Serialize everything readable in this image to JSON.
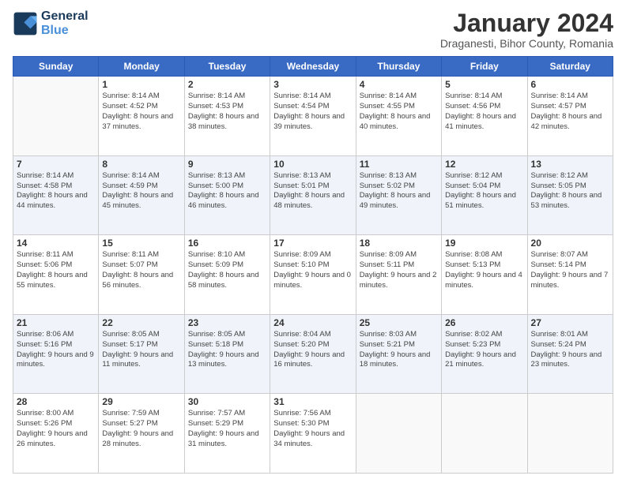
{
  "logo": {
    "line1": "General",
    "line2": "Blue"
  },
  "title": "January 2024",
  "subtitle": "Draganesti, Bihor County, Romania",
  "weekdays": [
    "Sunday",
    "Monday",
    "Tuesday",
    "Wednesday",
    "Thursday",
    "Friday",
    "Saturday"
  ],
  "weeks": [
    [
      {
        "day": "",
        "sunrise": "",
        "sunset": "",
        "daylight": ""
      },
      {
        "day": "1",
        "sunrise": "8:14 AM",
        "sunset": "4:52 PM",
        "daylight": "8 hours and 37 minutes."
      },
      {
        "day": "2",
        "sunrise": "8:14 AM",
        "sunset": "4:53 PM",
        "daylight": "8 hours and 38 minutes."
      },
      {
        "day": "3",
        "sunrise": "8:14 AM",
        "sunset": "4:54 PM",
        "daylight": "8 hours and 39 minutes."
      },
      {
        "day": "4",
        "sunrise": "8:14 AM",
        "sunset": "4:55 PM",
        "daylight": "8 hours and 40 minutes."
      },
      {
        "day": "5",
        "sunrise": "8:14 AM",
        "sunset": "4:56 PM",
        "daylight": "8 hours and 41 minutes."
      },
      {
        "day": "6",
        "sunrise": "8:14 AM",
        "sunset": "4:57 PM",
        "daylight": "8 hours and 42 minutes."
      }
    ],
    [
      {
        "day": "7",
        "sunrise": "8:14 AM",
        "sunset": "4:58 PM",
        "daylight": "8 hours and 44 minutes."
      },
      {
        "day": "8",
        "sunrise": "8:14 AM",
        "sunset": "4:59 PM",
        "daylight": "8 hours and 45 minutes."
      },
      {
        "day": "9",
        "sunrise": "8:13 AM",
        "sunset": "5:00 PM",
        "daylight": "8 hours and 46 minutes."
      },
      {
        "day": "10",
        "sunrise": "8:13 AM",
        "sunset": "5:01 PM",
        "daylight": "8 hours and 48 minutes."
      },
      {
        "day": "11",
        "sunrise": "8:13 AM",
        "sunset": "5:02 PM",
        "daylight": "8 hours and 49 minutes."
      },
      {
        "day": "12",
        "sunrise": "8:12 AM",
        "sunset": "5:04 PM",
        "daylight": "8 hours and 51 minutes."
      },
      {
        "day": "13",
        "sunrise": "8:12 AM",
        "sunset": "5:05 PM",
        "daylight": "8 hours and 53 minutes."
      }
    ],
    [
      {
        "day": "14",
        "sunrise": "8:11 AM",
        "sunset": "5:06 PM",
        "daylight": "8 hours and 55 minutes."
      },
      {
        "day": "15",
        "sunrise": "8:11 AM",
        "sunset": "5:07 PM",
        "daylight": "8 hours and 56 minutes."
      },
      {
        "day": "16",
        "sunrise": "8:10 AM",
        "sunset": "5:09 PM",
        "daylight": "8 hours and 58 minutes."
      },
      {
        "day": "17",
        "sunrise": "8:09 AM",
        "sunset": "5:10 PM",
        "daylight": "9 hours and 0 minutes."
      },
      {
        "day": "18",
        "sunrise": "8:09 AM",
        "sunset": "5:11 PM",
        "daylight": "9 hours and 2 minutes."
      },
      {
        "day": "19",
        "sunrise": "8:08 AM",
        "sunset": "5:13 PM",
        "daylight": "9 hours and 4 minutes."
      },
      {
        "day": "20",
        "sunrise": "8:07 AM",
        "sunset": "5:14 PM",
        "daylight": "9 hours and 7 minutes."
      }
    ],
    [
      {
        "day": "21",
        "sunrise": "8:06 AM",
        "sunset": "5:16 PM",
        "daylight": "9 hours and 9 minutes."
      },
      {
        "day": "22",
        "sunrise": "8:05 AM",
        "sunset": "5:17 PM",
        "daylight": "9 hours and 11 minutes."
      },
      {
        "day": "23",
        "sunrise": "8:05 AM",
        "sunset": "5:18 PM",
        "daylight": "9 hours and 13 minutes."
      },
      {
        "day": "24",
        "sunrise": "8:04 AM",
        "sunset": "5:20 PM",
        "daylight": "9 hours and 16 minutes."
      },
      {
        "day": "25",
        "sunrise": "8:03 AM",
        "sunset": "5:21 PM",
        "daylight": "9 hours and 18 minutes."
      },
      {
        "day": "26",
        "sunrise": "8:02 AM",
        "sunset": "5:23 PM",
        "daylight": "9 hours and 21 minutes."
      },
      {
        "day": "27",
        "sunrise": "8:01 AM",
        "sunset": "5:24 PM",
        "daylight": "9 hours and 23 minutes."
      }
    ],
    [
      {
        "day": "28",
        "sunrise": "8:00 AM",
        "sunset": "5:26 PM",
        "daylight": "9 hours and 26 minutes."
      },
      {
        "day": "29",
        "sunrise": "7:59 AM",
        "sunset": "5:27 PM",
        "daylight": "9 hours and 28 minutes."
      },
      {
        "day": "30",
        "sunrise": "7:57 AM",
        "sunset": "5:29 PM",
        "daylight": "9 hours and 31 minutes."
      },
      {
        "day": "31",
        "sunrise": "7:56 AM",
        "sunset": "5:30 PM",
        "daylight": "9 hours and 34 minutes."
      },
      {
        "day": "",
        "sunrise": "",
        "sunset": "",
        "daylight": ""
      },
      {
        "day": "",
        "sunrise": "",
        "sunset": "",
        "daylight": ""
      },
      {
        "day": "",
        "sunrise": "",
        "sunset": "",
        "daylight": ""
      }
    ]
  ],
  "labels": {
    "sunrise_prefix": "Sunrise: ",
    "sunset_prefix": "Sunset: ",
    "daylight_prefix": "Daylight: "
  }
}
